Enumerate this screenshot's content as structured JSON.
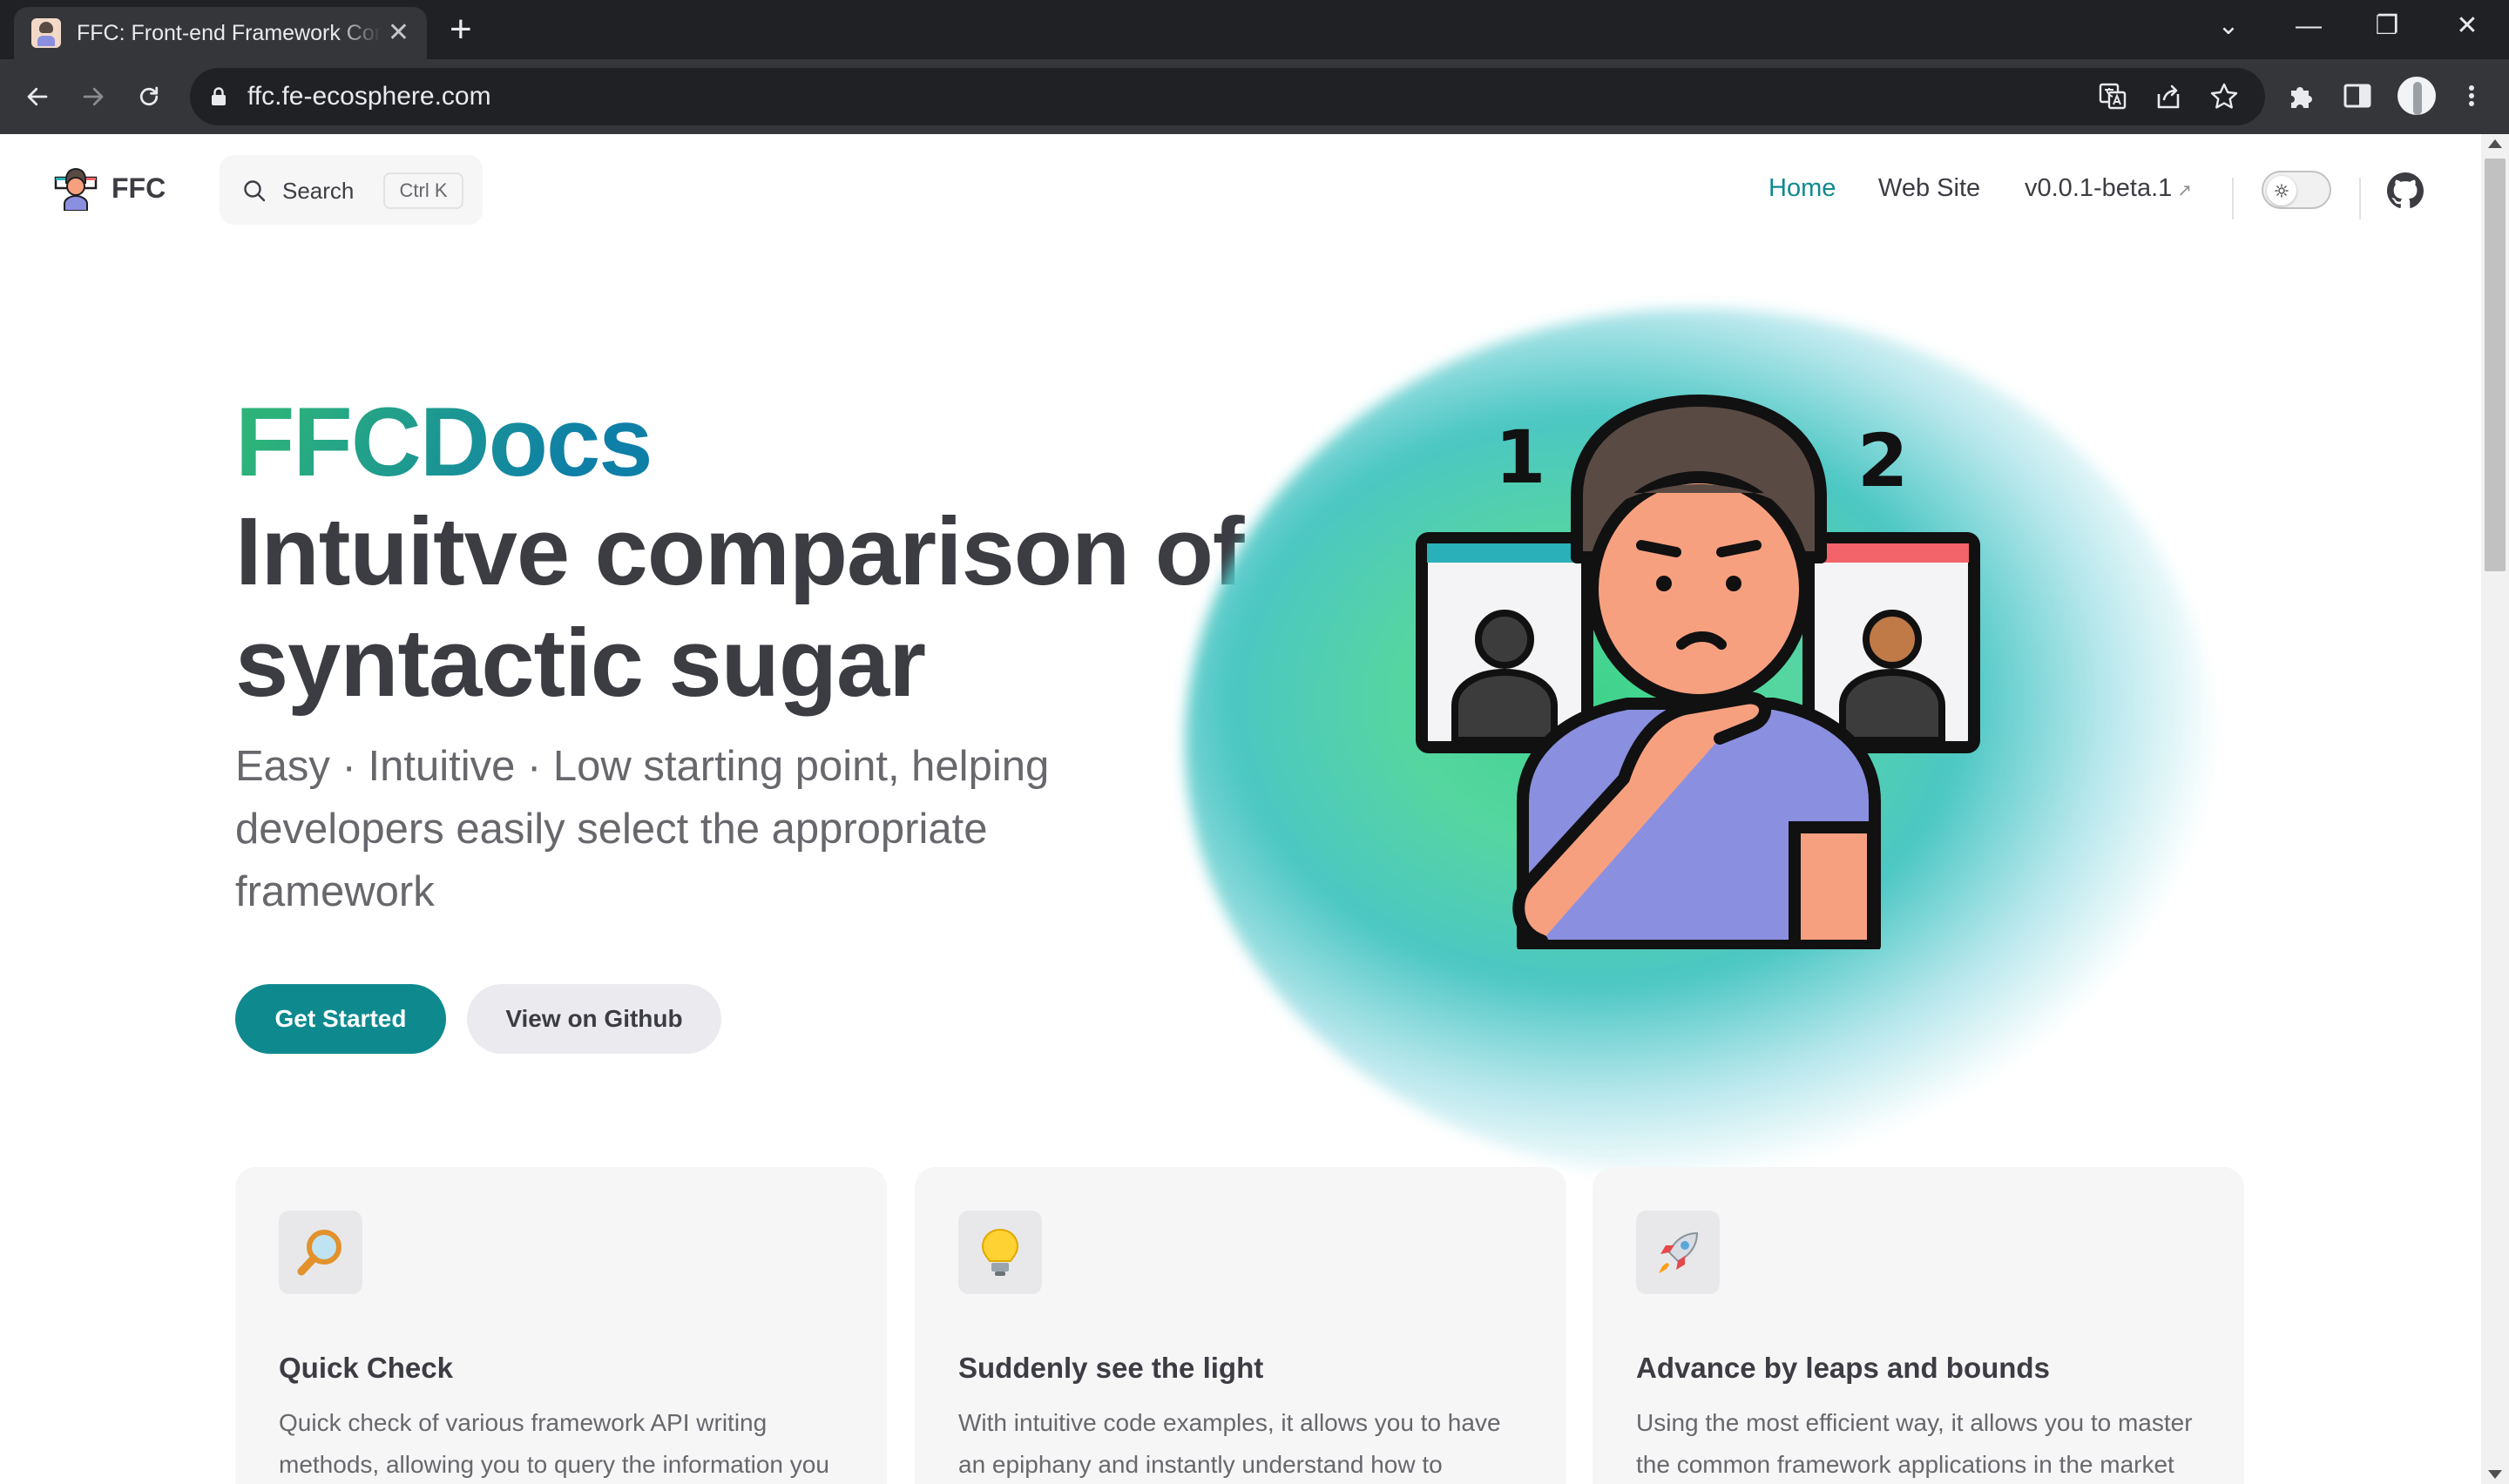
{
  "browser": {
    "tab_title": "FFC: Front-end Framework Comparison",
    "url": "ffc.fe-ecosphere.com",
    "new_tab": "+",
    "tab_close": "✕",
    "window_controls": {
      "dropdown": "⌄",
      "minimize": "—",
      "restore": "❐",
      "close": "✕"
    }
  },
  "nav": {
    "logo_text": "FFC",
    "search_label": "Search",
    "search_shortcut": "Ctrl K",
    "links": [
      {
        "label": "Home",
        "active": true
      },
      {
        "label": "Web Site",
        "active": false
      },
      {
        "label": "v0.0.1-beta.1",
        "external": true
      }
    ],
    "external_arrow": "↗"
  },
  "hero": {
    "name": "FFCDocs",
    "headline": "Intuitve comparison of syntactic sugar",
    "tagline": "Easy · Intuitive · Low starting point, helping developers easily select the appropriate framework",
    "image_labels": [
      "1",
      "2"
    ],
    "actions": {
      "primary": "Get Started",
      "secondary": "View on Github"
    }
  },
  "features": [
    {
      "icon": "magnifier-icon",
      "title": "Quick Check",
      "text": "Quick check of various framework API writing methods, allowing you to query the information you want in the most agile way"
    },
    {
      "icon": "lightbulb-icon",
      "title": "Suddenly see the light",
      "text": "With intuitive code examples, it allows you to have an epiphany and instantly understand how to achieve the same effect in different"
    },
    {
      "icon": "rocket-icon",
      "title": "Advance by leaps and bounds",
      "text": "Using the most efficient way, it allows you to master the common framework applications in the market with agility"
    }
  ],
  "colors": {
    "brand": "#0e8a8f",
    "brand_gradient_start": "#2db37a",
    "brand_gradient_end": "#0e7fa7",
    "text": "#3c3c43",
    "text_muted": "#67676c"
  }
}
